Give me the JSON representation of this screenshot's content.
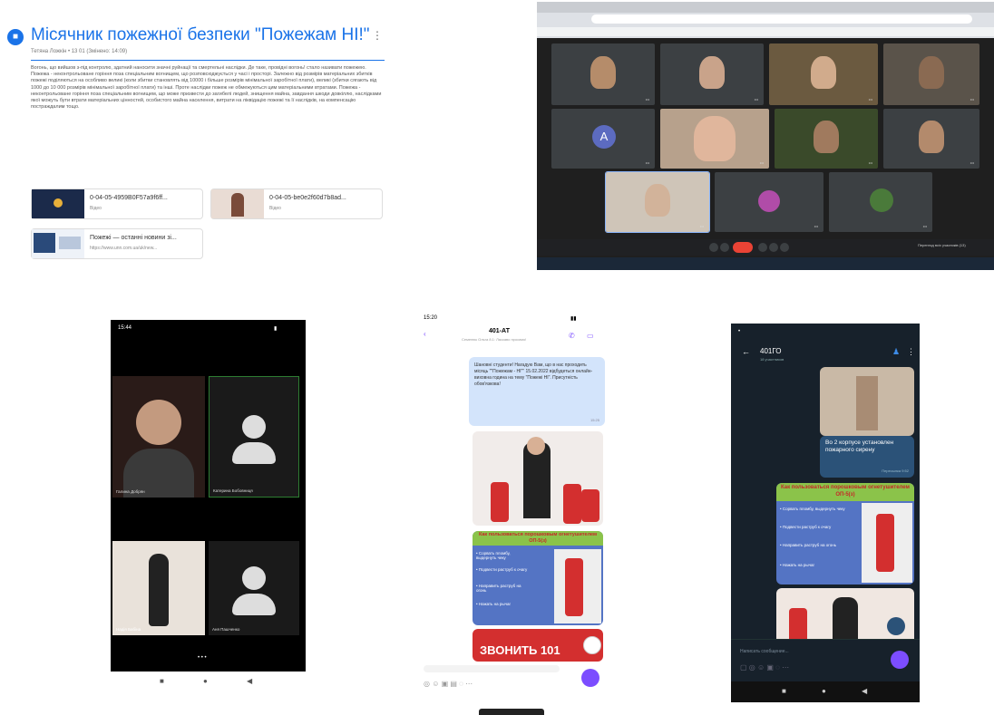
{
  "classroom": {
    "title": "Місячник пожежної безпеки \"Пожежам НІ!\"",
    "meta": "Тетяна Ложкін • 13 01 (Змінено: 14:09)",
    "body": "Вогонь, що вийшов з-під контролю, здатний наносити значні руйнації та смертельні наслідки. Де таке, провідні вогонь! стало називати пожежею. Пожежа - неконтрольоване горіння поза спеціальним вогнищем, що розповсюджується у часі і просторі. Залежно від розмірів матеріальних збитків пожежі поділяються на особливо великі (коли збитки становлять від 10000 і більше розмірів мінімальної заробітної плати), великі (збитки сягають від 1000 до 10 000 розмірів мінімальної заробітної плати) та інші. Проте наслідки пожеж не обмежуються цим матеріальними втратами. Пожежа - неконтрольоване горіння поза спеціальним вогнищем, що може призвести до загибелі людей, знищення майна, завдання шкоди довкіллю, наслідками якої можуть бути втрати матеріальних цінностей, особистого майна населення, витрати на ліквідацію пожежі та її наслідків, на компенсацію постраждалим тощо.",
    "attachments": [
      {
        "name": "0-04-05-4959B0F57a9f6ff...",
        "sub": "Відео"
      },
      {
        "name": "0-04-05-be0e2f60d7b8ad...",
        "sub": "Відео"
      },
      {
        "name": "Пожежі — останні новини зі...",
        "sub": "https://www.unn.com.ua/uk/new..."
      }
    ]
  },
  "meet": {
    "avatar_letter": "A",
    "bottom_info": "Перегляд всіх учасників (13)"
  },
  "viber": {
    "time": "15:20",
    "chat_title": "401-АТ",
    "chat_sub": "Семенюк Ольга 8.1: Ласкаво просимо!",
    "greeting": "Шановні студенти! Нагадую Вам, що в нас проходить місяць \"\"Пожежам - НІ\"\" 15.02.2022 відбудеться онлайн-виховна година на тему \"Пожежі НІ\". Присутність обов'язкова!",
    "greeting_time": "15:25",
    "poster_header": "Как пользоваться порошковым огнетушителем ОП-5(з)",
    "steps": [
      "• Сорвать пломбу, выдернуть чеку",
      "• Подвести раструб к очагу",
      "• Направить раструб на огонь",
      "• Нажать на рычаг"
    ],
    "banner": "ЗВОНИТЬ 101"
  },
  "duo": {
    "time": "15:44",
    "names": [
      "Галина Добрян",
      "Катерина Бобовниця",
      "Надія Бабіна",
      "Аня Пашченко"
    ]
  },
  "telegram": {
    "chat_title": "401ГО",
    "chat_sub": "18 участников",
    "msg1": "Во 2 корпусе установлен пожарного сирену",
    "msg1_time": "Пересылка 9:52",
    "poster_header": "Как пользоваться порошковым огнетушителем ОП-5(з)",
    "steps": [
      "• Сорвать пломбу, выдернуть чеку",
      "• Подвести раструб к очагу",
      "• Направить раструб на огонь",
      "• Нажать на рычаг"
    ],
    "input_placeholder": "Написать сообщение..."
  },
  "colors": {
    "google_blue": "#1a73e8",
    "meet_end": "#ea4335",
    "viber_purple": "#7c4dff",
    "tg_bg": "#17212b"
  }
}
